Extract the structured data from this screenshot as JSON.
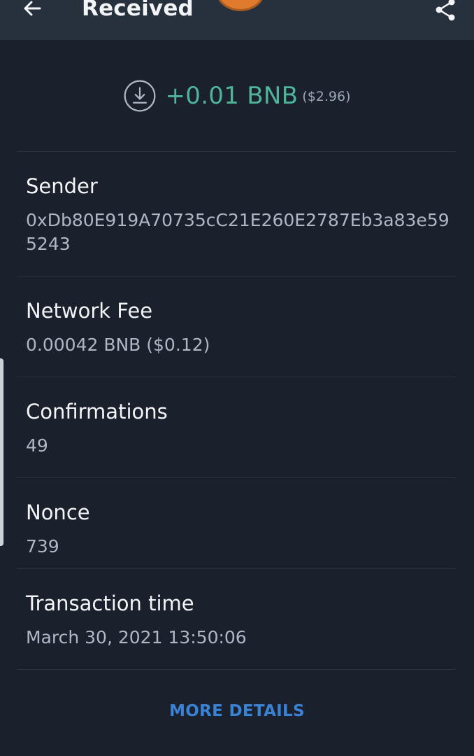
{
  "header": {
    "title": "Received",
    "icons": {
      "back": "arrow-left-icon",
      "share": "share-icon",
      "coin": "bnb-coin-avatar"
    }
  },
  "amount": {
    "value": "+0.01 BNB",
    "fiat": "($2.96)",
    "icon": "receive-download-icon",
    "color": "#4fb59a"
  },
  "details": {
    "sender": {
      "label": "Sender",
      "value": "0xDb80E919A70735cC21E260E2787Eb3a83e595243"
    },
    "network_fee": {
      "label": "Network Fee",
      "value": "0.00042 BNB ($0.12)"
    },
    "confirmations": {
      "label": "Confirmations",
      "value": "49"
    },
    "nonce": {
      "label": "Nonce",
      "value": "739"
    },
    "transaction_time": {
      "label": "Transaction time",
      "value": "March 30, 2021 13:50:06"
    }
  },
  "more_details_label": "MORE DETAILS",
  "colors": {
    "background": "#1a212c",
    "header": "#27313e",
    "link": "#3a82d6"
  }
}
